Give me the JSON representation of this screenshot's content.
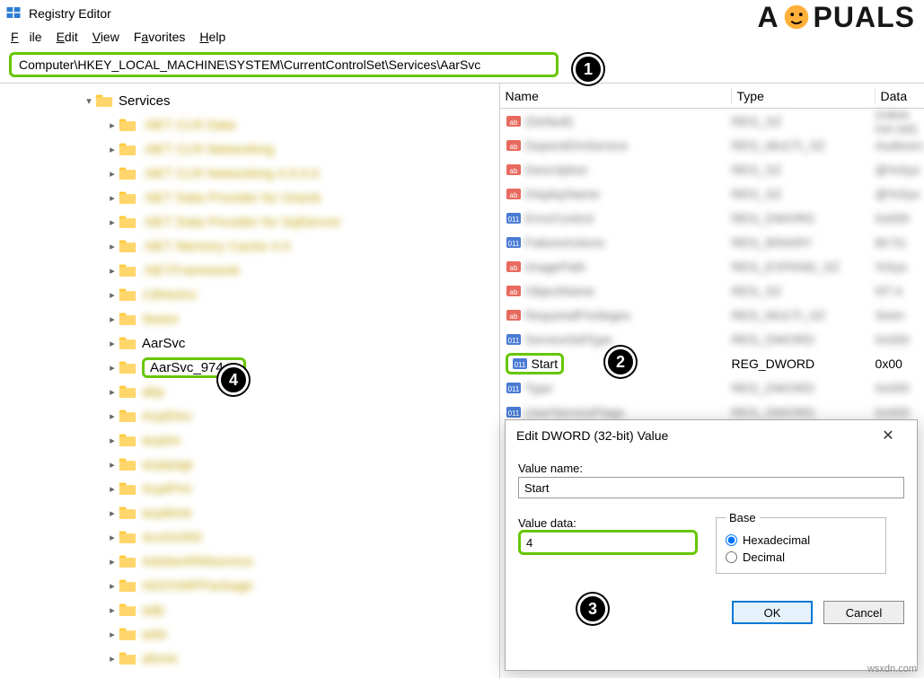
{
  "window": {
    "title": "Registry Editor"
  },
  "menu": {
    "file": "File",
    "edit": "Edit",
    "view": "View",
    "favorites": "Favorites",
    "help": "Help"
  },
  "address": {
    "path": "Computer\\HKEY_LOCAL_MACHINE\\SYSTEM\\CurrentControlSet\\Services\\AarSvc"
  },
  "tree": {
    "services_label": "Services",
    "blurred_before": [
      ".NET CLR Data",
      ".NET CLR Networking",
      ".NET CLR Networking 4.0.0.0",
      ".NET Data Provider for Oracle",
      ".NET Data Provider for SqlServer",
      ".NET Memory Cache 4.0",
      ".NETFramework",
      "1394ohci",
      "3ware"
    ],
    "aarsvc": "AarSvc",
    "aarsvc_974ea": "AarSvc_974ea",
    "blurred_after": [
      "abp",
      "AcpiDev",
      "acpiex",
      "acpipagr",
      "AcpiPmi",
      "acpitime",
      "Acx01000",
      "AdobeARMservice",
      "ADOVMPPackage",
      "adp",
      "adsi",
      "afunix"
    ]
  },
  "list": {
    "headers": {
      "name": "Name",
      "type": "Type",
      "data": "Data"
    },
    "blurred_before": [
      [
        "(Default)",
        "REG_SZ",
        "(value not set)"
      ],
      [
        "DependOnService",
        "REG_MULTI_SZ",
        "Audiosrv"
      ],
      [
        "Description",
        "REG_SZ",
        "@%Sys"
      ],
      [
        "DisplayName",
        "REG_SZ",
        "@%Sys"
      ],
      [
        "ErrorControl",
        "REG_DWORD",
        "0x000"
      ],
      [
        "FailureActions",
        "REG_BINARY",
        "80 51"
      ],
      [
        "ImagePath",
        "REG_EXPAND_SZ",
        "%Sys"
      ],
      [
        "ObjectName",
        "REG_SZ",
        "NT A"
      ],
      [
        "RequiredPrivileges",
        "REG_MULTI_SZ",
        "SeIm"
      ],
      [
        "ServiceSidType",
        "REG_DWORD",
        "0x000"
      ]
    ],
    "start_row": {
      "name": "Start",
      "type": "REG_DWORD",
      "data": "0x00"
    },
    "blurred_after": [
      [
        "Type",
        "REG_DWORD",
        "0x000"
      ],
      [
        "UserServiceFlags",
        "REG_DWORD",
        "0x000"
      ]
    ]
  },
  "dialog": {
    "title": "Edit DWORD (32-bit) Value",
    "value_name_label": "Value name:",
    "value_name": "Start",
    "value_data_label": "Value data:",
    "value_data": "4",
    "base_label": "Base",
    "hex": "Hexadecimal",
    "dec": "Decimal",
    "ok": "OK",
    "cancel": "Cancel"
  },
  "badges": {
    "b1": "1",
    "b2": "2",
    "b3": "3",
    "b4": "4"
  },
  "brand": {
    "text_left": "A",
    "text_right": "PUALS"
  },
  "watermark": "wsxdn.com"
}
